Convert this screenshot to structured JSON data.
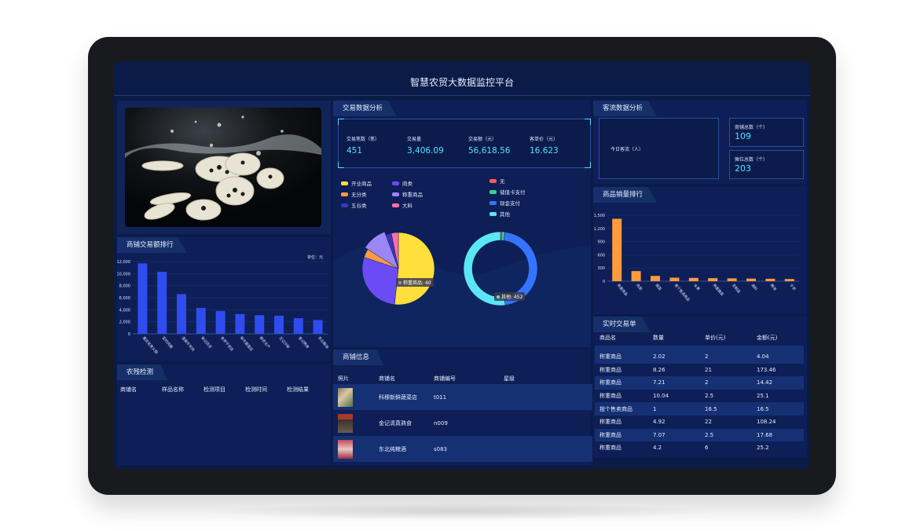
{
  "title": "智慧农贸大数据监控平台",
  "panels": {
    "trade": "交易数据分析",
    "shop_rank": "商铺交易额排行",
    "pesticide": "农残检测",
    "shop_info": "商铺信息",
    "traffic": "客流数据分析",
    "goods_rank": "商品销量排行",
    "realtime": "实时交易单"
  },
  "stats": [
    {
      "label": "交易笔数（笔）",
      "value": "451"
    },
    {
      "label": "交易量",
      "value": "3,406.09"
    },
    {
      "label": "交易额（元）",
      "value": "56,618.56"
    },
    {
      "label": "客单价（元）",
      "value": "16.623"
    }
  ],
  "traffic": {
    "today_label": "今日客流（人）",
    "shops_label": "商铺总数（个）",
    "shops_value": "109",
    "stalls_label": "摊位总数（个）",
    "stalls_value": "203"
  },
  "legend_left": [
    {
      "name": "开业商品",
      "color": "#ffdf3b"
    },
    {
      "name": "肉类",
      "color": "#6a4cf5"
    },
    {
      "name": "无分类",
      "color": "#ff9a45"
    },
    {
      "name": "称重商品",
      "color": "#9b86f5"
    },
    {
      "name": "五谷类",
      "color": "#3a36b8"
    },
    {
      "name": "大料",
      "color": "#ff6fa6"
    }
  ],
  "legend_right": [
    {
      "name": "无",
      "color": "#ff5a5a"
    },
    {
      "name": "储值卡支付",
      "color": "#3bd38c"
    },
    {
      "name": "现金支付",
      "color": "#3474ff"
    },
    {
      "name": "其他",
      "color": "#5ae6f5"
    }
  ],
  "pie_tooltip": "称重商品: 40",
  "donut_tooltip": "其他: 452",
  "pesticide_columns": [
    "商铺名",
    "样品名称",
    "检测项目",
    "检测时间",
    "检测结果"
  ],
  "shop_info_columns": [
    "照片",
    "商铺名",
    "商铺编号",
    "星级"
  ],
  "shops": [
    {
      "name": "科穆新鲜蔬菜店",
      "code": "t011"
    },
    {
      "name": "金记清真熟食",
      "code": "n009"
    },
    {
      "name": "东北纯粮酒",
      "code": "s083"
    }
  ],
  "realtime_columns": [
    "商品名",
    "数量",
    "单价(元)",
    "金额(元)"
  ],
  "realtime_rows": [
    [
      "称重商品",
      "2.02",
      "2",
      "4.04"
    ],
    [
      "称重商品",
      "8.26",
      "21",
      "173.46"
    ],
    [
      "称重商品",
      "7.21",
      "2",
      "14.42"
    ],
    [
      "称重商品",
      "10.04",
      "2.5",
      "25.1"
    ],
    [
      "按个售卖商品",
      "1",
      "16.5",
      "16.5"
    ],
    [
      "称重商品",
      "4.92",
      "22",
      "108.24"
    ],
    [
      "称重商品",
      "7.07",
      "2.5",
      "17.68"
    ],
    [
      "称重商品",
      "4.2",
      "6",
      "25.2"
    ]
  ],
  "chart_data": [
    {
      "type": "bar",
      "name_unit": "单位：元",
      "ylim": [
        0,
        12000
      ],
      "yticks": [
        "0",
        "2,000",
        "4,000",
        "6,000",
        "8,000",
        "10,000",
        "12,000"
      ],
      "categories": [
        "重庆名家火锅",
        "宏欣肉蛋",
        "清真牛羊肉",
        "张记百货",
        "老李干货店",
        "和平蔬菜店",
        "鲜农水产",
        "王记冷鲜",
        "金记熟食",
        "东北粮油"
      ],
      "values": [
        11700,
        10300,
        6600,
        4300,
        3800,
        3300,
        3100,
        3000,
        2600,
        2300
      ],
      "color": "#2f4cf0"
    },
    {
      "type": "bar",
      "ylim": [
        0,
        1500
      ],
      "yticks": [
        "0",
        "300",
        "600",
        "900",
        "1,200",
        "1,500"
      ],
      "categories": [
        "称重商品",
        "肉类",
        "蔬菜",
        "按个售卖商品",
        "水果",
        "称重蔬菜",
        "豆制品",
        "调料",
        "粮油",
        "干货"
      ],
      "values": [
        1420,
        230,
        120,
        80,
        75,
        70,
        65,
        60,
        55,
        50
      ],
      "color": "#ff9a3d"
    },
    {
      "type": "pie",
      "categories": [
        "开业商品",
        "肉类",
        "无分类",
        "称重商品",
        "五谷类",
        "大料"
      ],
      "values": [
        200,
        110,
        15,
        40,
        10,
        12
      ],
      "colors": [
        "#ffdf3b",
        "#6a4cf5",
        "#ff9a45",
        "#9b86f5",
        "#3a36b8",
        "#ff6fa6"
      ]
    },
    {
      "type": "pie",
      "donut": true,
      "categories": [
        "无",
        "储值卡支付",
        "现金支付",
        "其他"
      ],
      "values": [
        4,
        12,
        400,
        452
      ],
      "colors": [
        "#ff5a5a",
        "#3bd38c",
        "#3474ff",
        "#5ae6f5"
      ]
    }
  ]
}
